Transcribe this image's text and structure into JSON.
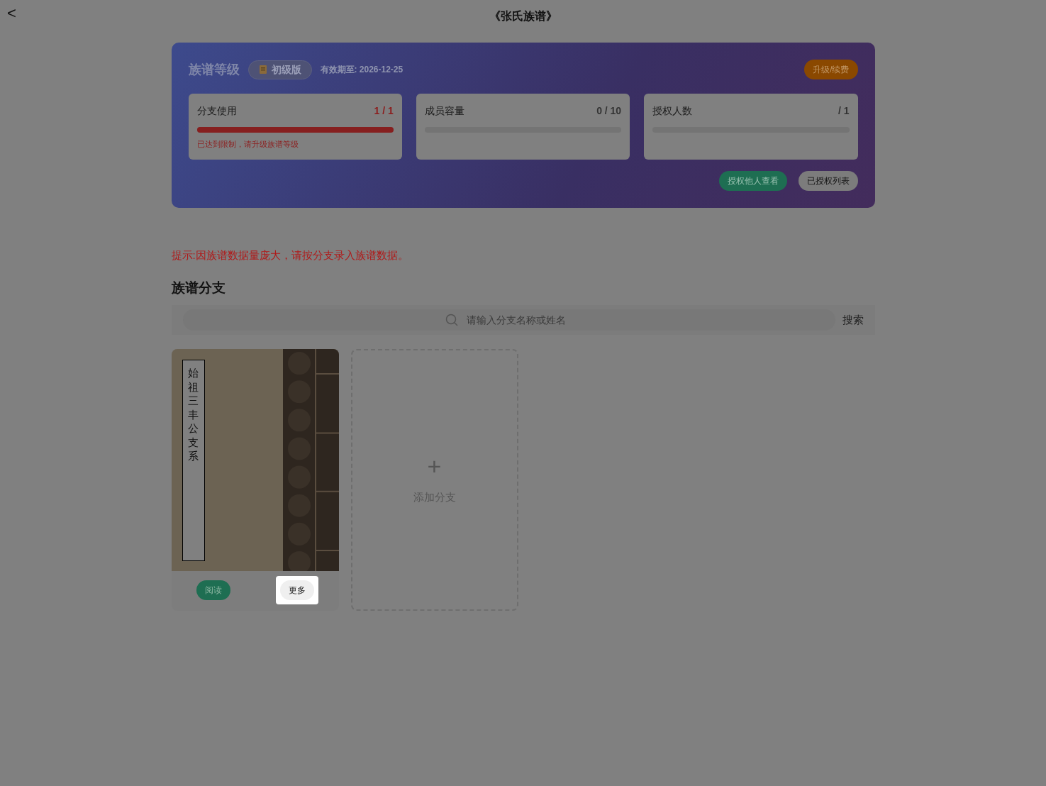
{
  "header": {
    "back": "<",
    "title": "《张氏族谱》"
  },
  "level_panel": {
    "title": "族谱等级",
    "badge": "初级版",
    "expiry": "有效期至: 2026-12-25",
    "upgrade_button": "升级/续费",
    "stats": [
      {
        "label": "分支使用",
        "value": "1 / 1",
        "level": 1,
        "warning": true,
        "note": "已达到限制，请升级族谱等级"
      },
      {
        "label": "成员容量",
        "value": "0 / 10",
        "level": 0,
        "warning": false
      },
      {
        "label": "授权人数",
        "value": "/ 1",
        "level": 0,
        "warning": false
      }
    ],
    "actions": [
      {
        "label": "授权他人查看",
        "kind": "primary"
      },
      {
        "label": "已授权列表",
        "kind": "secondary"
      }
    ]
  },
  "tip": "提示:因族谱数据量庞大，请按分支录入族谱数据。",
  "section_title": "族谱分支",
  "search": {
    "placeholder": "请输入分支名称或姓名",
    "button": "搜索"
  },
  "branches": [
    {
      "title": "始祖三丰公支系",
      "read_button": "阅读",
      "more_button": "更多",
      "more_highlighted": true
    }
  ],
  "add_branch": {
    "icon": "+",
    "label": "添加分支"
  }
}
